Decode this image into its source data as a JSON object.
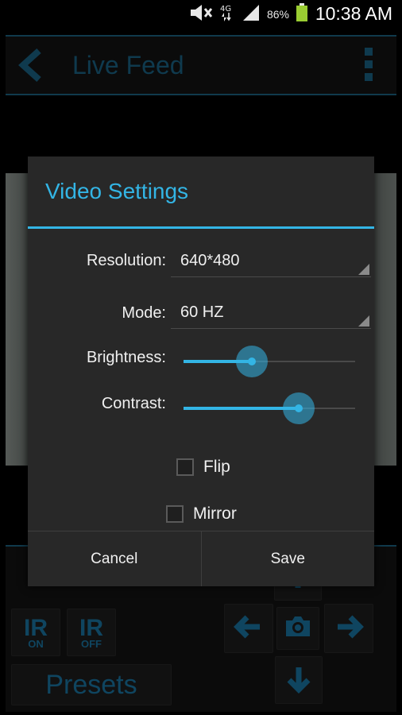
{
  "status_bar": {
    "battery_percent": "86%",
    "network": "4G",
    "time": "10:38 AM",
    "icons": [
      "mute-icon",
      "network-4g-icon",
      "signal-icon",
      "battery-icon"
    ]
  },
  "action_bar": {
    "title": "Live Feed",
    "back_icon": "back-arrow-icon",
    "overflow_icon": "overflow-menu-icon"
  },
  "controls": {
    "ir_on": {
      "top": "IR",
      "bottom": "ON"
    },
    "ir_off": {
      "top": "IR",
      "bottom": "OFF"
    },
    "presets_label": "Presets",
    "icons": [
      "arrow-up-icon",
      "arrow-left-icon",
      "camera-icon",
      "arrow-right-icon",
      "arrow-down-icon"
    ]
  },
  "dialog": {
    "title": "Video Settings",
    "resolution": {
      "label": "Resolution:",
      "value": "640*480"
    },
    "mode": {
      "label": "Mode:",
      "value": "60 HZ"
    },
    "brightness": {
      "label": "Brightness:",
      "value_fraction": 0.4
    },
    "contrast": {
      "label": "Contrast:",
      "value_fraction": 0.67
    },
    "flip": {
      "label": "Flip",
      "checked": false
    },
    "mirror": {
      "label": "Mirror",
      "checked": false
    },
    "cancel_label": "Cancel",
    "save_label": "Save"
  },
  "colors": {
    "accent": "#33b5e5",
    "dialog_bg": "#282828",
    "app_accent": "#1d6a8f"
  }
}
